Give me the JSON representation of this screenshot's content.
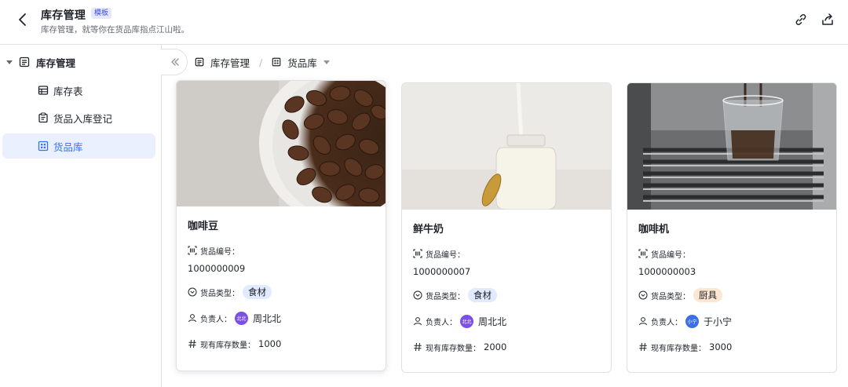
{
  "header": {
    "title": "库存管理",
    "badge": "模板",
    "subtitle": "库存管理，就等你在货品库指点江山啦。"
  },
  "sidebar": {
    "root": {
      "label": "库存管理"
    },
    "items": [
      {
        "label": "库存表"
      },
      {
        "label": "货品入库登记"
      },
      {
        "label": "货品库"
      }
    ]
  },
  "toolbar": {
    "crumbs": [
      {
        "label": "库存管理"
      },
      {
        "label": "货品库"
      }
    ],
    "separator": "/"
  },
  "fields": {
    "code_label": "货品编号：",
    "type_label": "货品类型：",
    "owner_label": "负责人：",
    "stock_label": "现有库存数量："
  },
  "cards": [
    {
      "title": "咖啡豆",
      "code": "1000000009",
      "type": "食材",
      "owner": "周北北",
      "avatar_text": "北北",
      "stock": "1000"
    },
    {
      "title": "鲜牛奶",
      "code": "1000000007",
      "type": "食材",
      "owner": "周北北",
      "avatar_text": "北北",
      "stock": "2000"
    },
    {
      "title": "咖啡机",
      "code": "1000000003",
      "type": "厨具",
      "owner": "于小宁",
      "avatar_text": "小宁",
      "stock": "3000"
    }
  ],
  "colors": {
    "accent": "#3370ff",
    "active_bg": "#eaf0fd",
    "food_tag": "#e1eaff",
    "kitchen_tag": "#fde6d2",
    "avatar_purple": "#7b4fe3",
    "avatar_blue": "#3b6fe8"
  },
  "icons": [
    "back-arrow-icon",
    "link-icon",
    "share-icon",
    "table-icon",
    "form-icon",
    "gallery-icon",
    "barcode-icon",
    "circle-chevron-icon",
    "person-icon",
    "hash-icon"
  ]
}
